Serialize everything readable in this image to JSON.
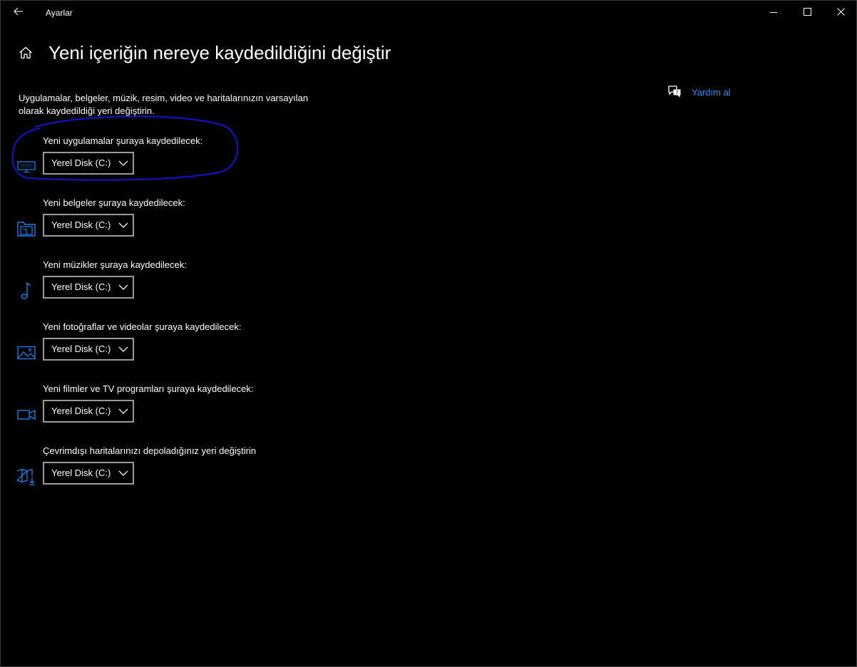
{
  "window": {
    "app_title": "Ayarlar",
    "back_icon": "arrow-left-icon",
    "minimize_icon": "minimize-icon",
    "maximize_icon": "maximize-icon",
    "close_icon": "close-icon"
  },
  "header": {
    "home_icon": "home-icon",
    "page_title": "Yeni içeriğin nereye kaydedildiğini değiştir"
  },
  "description": "Uygulamalar, belgeler, müzik, resim, video ve haritalarınızın varsayılan olarak kaydedildiği yeri değiştirin.",
  "help": {
    "icon": "help-chat-icon",
    "label": "Yardım al"
  },
  "accent_color": "#1a7fe6",
  "annotation_color": "#1414d0",
  "settings": [
    {
      "label": "Yeni uygulamalar şuraya kaydedilecek:",
      "value": "Yerel Disk (C:)",
      "icon": "monitor-icon"
    },
    {
      "label": "Yeni belgeler şuraya kaydedilecek:",
      "value": "Yerel Disk (C:)",
      "icon": "documents-drive-icon"
    },
    {
      "label": "Yeni müzikler şuraya kaydedilecek:",
      "value": "Yerel Disk (C:)",
      "icon": "music-note-icon"
    },
    {
      "label": "Yeni fotoğraflar ve videolar şuraya kaydedilecek:",
      "value": "Yerel Disk (C:)",
      "icon": "picture-icon"
    },
    {
      "label": "Yeni filmler ve TV programları şuraya kaydedilecek:",
      "value": "Yerel Disk (C:)",
      "icon": "video-camera-icon"
    },
    {
      "label": "Çevrimdışı haritalarınızı depoladığınız yeri değiştirin",
      "value": "Yerel Disk (C:)",
      "icon": "map-download-icon"
    }
  ]
}
